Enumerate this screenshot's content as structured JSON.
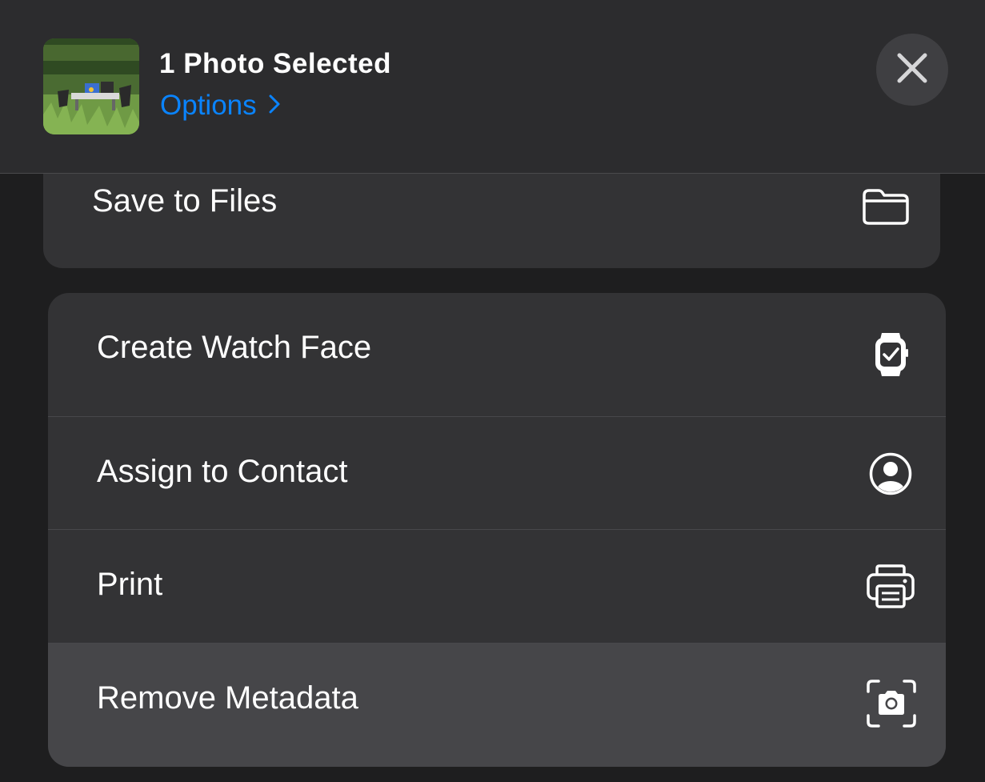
{
  "header": {
    "title": "1 Photo Selected",
    "options_label": "Options",
    "thumbnail_icon": "photo-thumbnail",
    "close_icon": "close-icon"
  },
  "actions_top": [
    {
      "label": "Save to Files",
      "icon": "folder-icon"
    }
  ],
  "actions_main": [
    {
      "label": "Create Watch Face",
      "icon": "watch-icon"
    },
    {
      "label": "Assign to Contact",
      "icon": "contact-icon"
    },
    {
      "label": "Print",
      "icon": "printer-icon"
    },
    {
      "label": "Remove Metadata",
      "icon": "camera-viewfinder-icon"
    }
  ],
  "colors": {
    "accent": "#0a84ff",
    "sheet": "#2c2c2e",
    "group": "#333335",
    "highlight": "#464649"
  }
}
